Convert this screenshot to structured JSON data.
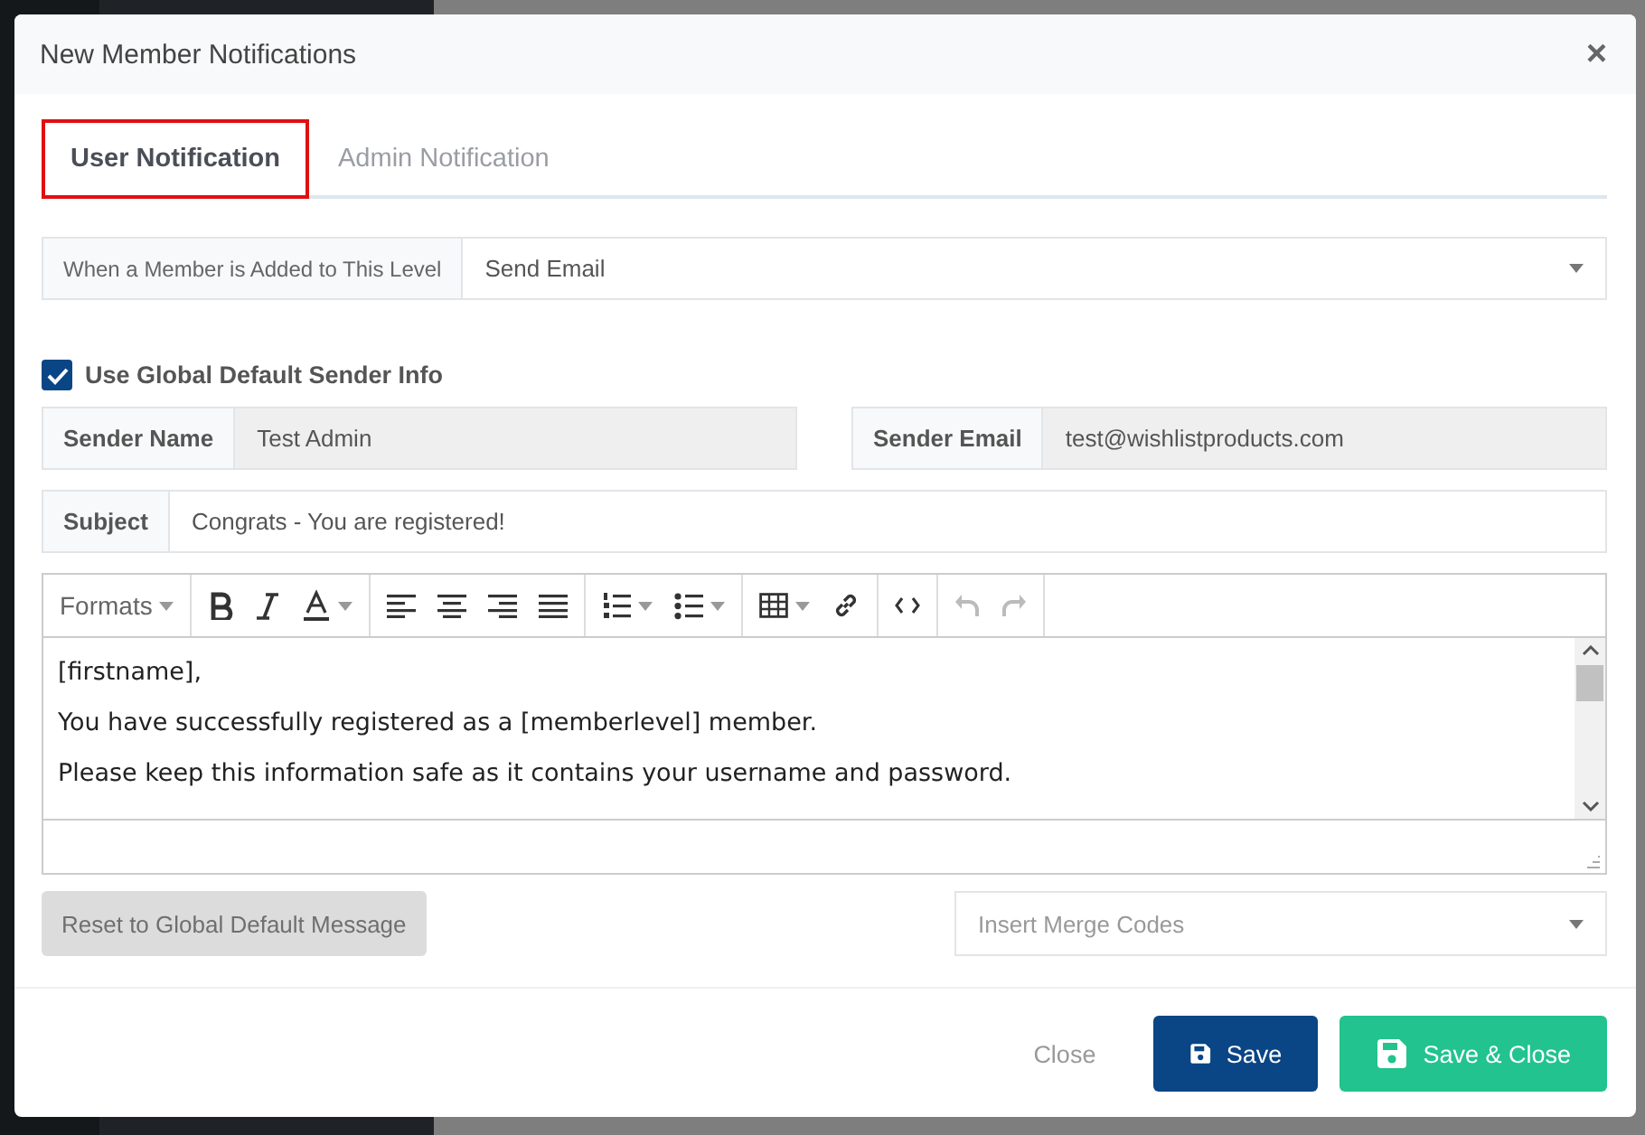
{
  "modal": {
    "title": "New Member Notifications",
    "close": "×"
  },
  "tabs": [
    {
      "label": "User Notification",
      "selected": true,
      "highlighted": true
    },
    {
      "label": "Admin Notification",
      "selected": false,
      "highlighted": false
    }
  ],
  "trigger": {
    "label": "When a Member is Added to This Level",
    "value": "Send Email"
  },
  "use_global_sender": {
    "label": "Use Global Default Sender Info",
    "checked": true
  },
  "sender_fields": [
    {
      "label": "Sender Name",
      "value": "Test Admin",
      "disabled": true
    },
    {
      "label": "Sender Email",
      "value": "test@wishlistproducts.com",
      "disabled": true
    }
  ],
  "subject": {
    "label": "Subject",
    "value": "Congrats - You are registered!",
    "disabled": false
  },
  "editor": {
    "formats": "Formats",
    "history": [
      {
        "kind": "undo",
        "disabled": true
      },
      {
        "kind": "redo",
        "disabled": true
      }
    ],
    "paragraphs": [
      "[firstname],",
      "You have successfully registered as a [memberlevel] member.",
      "Please keep this information safe as it contains your username and password."
    ]
  },
  "reset_button": {
    "label": "Reset to Global Default Message",
    "disabled": true
  },
  "merge_codes": {
    "placeholder": "Insert Merge Codes"
  },
  "footer_buttons": [
    {
      "label": "Close",
      "kind": "link"
    },
    {
      "label": "Save",
      "kind": "primary"
    },
    {
      "label": "Save & Close",
      "kind": "success"
    }
  ]
}
